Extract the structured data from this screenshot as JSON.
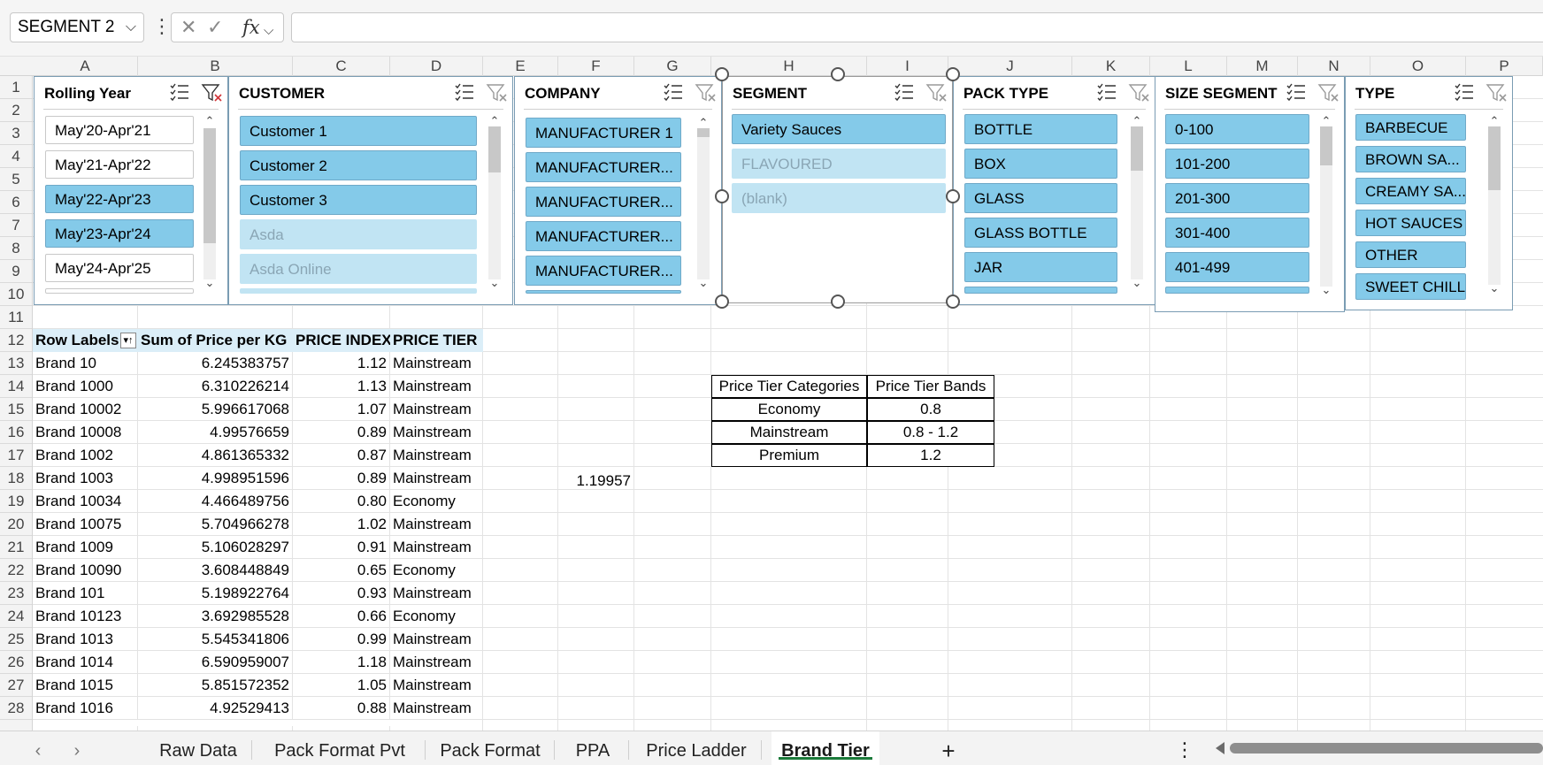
{
  "formula_bar": {
    "name_box": "SEGMENT 2",
    "cancel_icon": "✕",
    "enter_icon": "✓",
    "fx_label": "fx",
    "formula": ""
  },
  "columns": [
    "A",
    "B",
    "C",
    "D",
    "E",
    "F",
    "G",
    "H",
    "I",
    "J",
    "K",
    "L",
    "M",
    "N",
    "O",
    "P"
  ],
  "rows": [
    "1",
    "2",
    "3",
    "4",
    "5",
    "6",
    "7",
    "8",
    "9",
    "10",
    "11",
    "12",
    "13",
    "14",
    "15",
    "16",
    "17",
    "18",
    "19",
    "20",
    "21",
    "22",
    "23",
    "24",
    "25",
    "26",
    "27",
    "28"
  ],
  "slicers": {
    "rolling_year": {
      "title": "Rolling Year",
      "items": [
        {
          "label": "May'20-Apr'21",
          "state": "unselected"
        },
        {
          "label": "May'21-Apr'22",
          "state": "unselected"
        },
        {
          "label": "May'22-Apr'23",
          "state": "selected"
        },
        {
          "label": "May'23-Apr'24",
          "state": "selected"
        },
        {
          "label": "May'24-Apr'25",
          "state": "unselected"
        }
      ]
    },
    "customer": {
      "title": "CUSTOMER",
      "items": [
        {
          "label": "Customer 1",
          "state": "selected"
        },
        {
          "label": "Customer 2",
          "state": "selected"
        },
        {
          "label": "Customer 3",
          "state": "selected"
        },
        {
          "label": "Asda",
          "state": "dim"
        },
        {
          "label": "Asda Online",
          "state": "dim"
        }
      ]
    },
    "company": {
      "title": "COMPANY",
      "items": [
        {
          "label": "MANUFACTURER 1",
          "state": "selected"
        },
        {
          "label": "MANUFACTURER...",
          "state": "selected"
        },
        {
          "label": "MANUFACTURER...",
          "state": "selected"
        },
        {
          "label": "MANUFACTURER...",
          "state": "selected"
        },
        {
          "label": "MANUFACTURER...",
          "state": "selected"
        }
      ]
    },
    "segment": {
      "title": "SEGMENT",
      "items": [
        {
          "label": "Variety Sauces",
          "state": "selected"
        },
        {
          "label": "FLAVOURED",
          "state": "dim"
        },
        {
          "label": "(blank)",
          "state": "dim"
        }
      ]
    },
    "pack_type": {
      "title": "PACK TYPE",
      "items": [
        {
          "label": "BOTTLE",
          "state": "selected"
        },
        {
          "label": "BOX",
          "state": "selected"
        },
        {
          "label": "GLASS",
          "state": "selected"
        },
        {
          "label": "GLASS BOTTLE",
          "state": "selected"
        },
        {
          "label": "JAR",
          "state": "selected"
        }
      ]
    },
    "size_segment": {
      "title": "SIZE SEGMENT",
      "items": [
        {
          "label": "0-100",
          "state": "selected"
        },
        {
          "label": "101-200",
          "state": "selected"
        },
        {
          "label": "201-300",
          "state": "selected"
        },
        {
          "label": "301-400",
          "state": "selected"
        },
        {
          "label": "401-499",
          "state": "selected"
        }
      ]
    },
    "type": {
      "title": "TYPE",
      "items": [
        {
          "label": "BARBECUE",
          "state": "selected"
        },
        {
          "label": "BROWN SA...",
          "state": "selected"
        },
        {
          "label": "CREAMY SA...",
          "state": "selected"
        },
        {
          "label": "HOT SAUCES",
          "state": "selected"
        },
        {
          "label": "OTHER",
          "state": "selected"
        },
        {
          "label": "SWEET CHILLI",
          "state": "selected"
        }
      ]
    }
  },
  "pivot": {
    "headers": [
      "Row Labels",
      "Sum of Price per KG",
      "PRICE INDEX",
      "PRICE TIER"
    ],
    "rows": [
      [
        "Brand 10",
        "6.245383757",
        "1.12",
        "Mainstream"
      ],
      [
        "Brand 1000",
        "6.310226214",
        "1.13",
        "Mainstream"
      ],
      [
        "Brand 10002",
        "5.996617068",
        "1.07",
        "Mainstream"
      ],
      [
        "Brand 10008",
        "4.99576659",
        "0.89",
        "Mainstream"
      ],
      [
        "Brand 1002",
        "4.861365332",
        "0.87",
        "Mainstream"
      ],
      [
        "Brand 1003",
        "4.998951596",
        "0.89",
        "Mainstream"
      ],
      [
        "Brand 10034",
        "4.466489756",
        "0.80",
        "Economy"
      ],
      [
        "Brand 10075",
        "5.704966278",
        "1.02",
        "Mainstream"
      ],
      [
        "Brand 1009",
        "5.106028297",
        "0.91",
        "Mainstream"
      ],
      [
        "Brand 10090",
        "3.608448849",
        "0.65",
        "Economy"
      ],
      [
        "Brand 101",
        "5.198922764",
        "0.93",
        "Mainstream"
      ],
      [
        "Brand 10123",
        "3.692985528",
        "0.66",
        "Economy"
      ],
      [
        "Brand 1013",
        "5.545341806",
        "0.99",
        "Mainstream"
      ],
      [
        "Brand 1014",
        "6.590959007",
        "1.18",
        "Mainstream"
      ],
      [
        "Brand 1015",
        "5.851572352",
        "1.05",
        "Mainstream"
      ],
      [
        "Brand 1016",
        "4.92529413",
        "0.88",
        "Mainstream"
      ]
    ]
  },
  "f18_value": "1.19957",
  "price_tier_table": {
    "headers": [
      "Price Tier Categories",
      "Price Tier Bands"
    ],
    "rows": [
      [
        "Economy",
        "0.8"
      ],
      [
        "Mainstream",
        "0.8 - 1.2"
      ],
      [
        "Premium",
        "1.2"
      ]
    ]
  },
  "sheet_tabs": {
    "tabs": [
      "Raw Data",
      "Pack Format Pvt",
      "Pack Format",
      "PPA",
      "Price Ladder",
      "Brand Tier"
    ],
    "active": "Brand Tier",
    "add_label": "+"
  },
  "colors": {
    "selected_item": "#84cae9",
    "dim_item": "#c1e4f3",
    "header_fill": "#dbeef8",
    "active_tab_underline": "#1b7a3a"
  }
}
